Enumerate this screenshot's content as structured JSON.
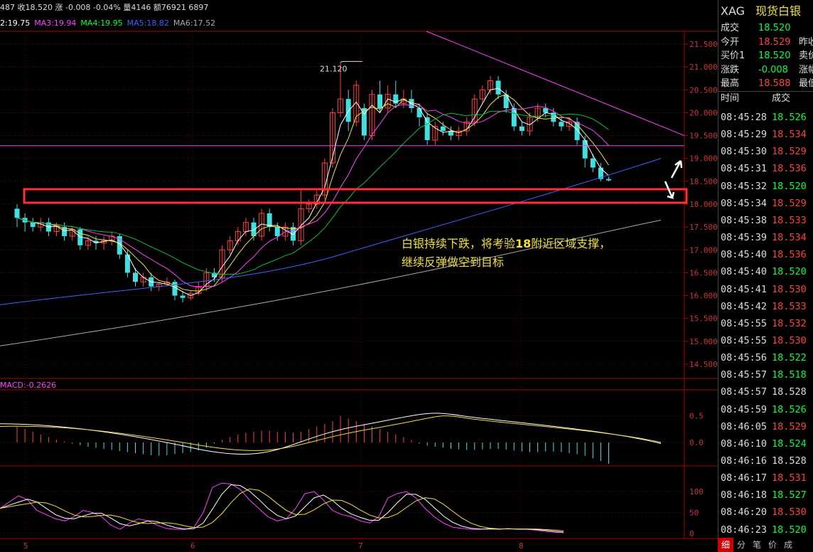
{
  "quote_bar": {
    "price_label": "487 收18.520 涨 -0.008 -0.04% 量4146 额76921 6897"
  },
  "ma_bar": [
    {
      "text": "2:19.75",
      "color": "#ffffff"
    },
    {
      "text": "MA3:19.94",
      "color": "#ff40ff"
    },
    {
      "text": "MA4:19.95",
      "color": "#00ff40"
    },
    {
      "text": "MA5:18.82",
      "color": "#4060ff"
    },
    {
      "text": "MA6:17.52",
      "color": "#aaaaaa"
    }
  ],
  "price_axis": [
    "21.500",
    "21.000",
    "20.500",
    "20.000",
    "19.500",
    "19.000",
    "18.500",
    "18.000",
    "17.500",
    "17.000",
    "16.500",
    "16.000",
    "15.500",
    "15.000",
    "14.500"
  ],
  "peak_label": "21.120",
  "annotation": {
    "line1_a": "白银持续下跌，将考验",
    "line1_b": "18",
    "line1_c": "附近区域支撑，",
    "line2": "继续反弹做空到目标"
  },
  "macd_label": "MACD:-0.2626",
  "macd_axis": [
    "0.5",
    "0.0"
  ],
  "kdj_axis": [
    "100",
    "50",
    "0"
  ],
  "date_axis": [
    "5",
    "6",
    "7",
    "8"
  ],
  "right_panel": {
    "symbol": "XAG",
    "name": "现货白银",
    "fields": [
      {
        "k": "成交",
        "v": "18.520",
        "color": "#00ff40",
        "e": ""
      },
      {
        "k": "今开",
        "v": "18.529",
        "color": "#ff4040",
        "e": "昨收"
      },
      {
        "k": "买价1",
        "v": "18.520",
        "color": "#00ff40",
        "e": "卖价"
      },
      {
        "k": "涨跌",
        "v": "-0.008",
        "color": "#00ff40",
        "e": "涨幅"
      },
      {
        "k": "最高",
        "v": "18.588",
        "color": "#ff4040",
        "e": "最低"
      }
    ],
    "tick_header": {
      "time": "时间",
      "price": "成交"
    },
    "ticks": [
      {
        "t": "08:45:28",
        "p": "18.526",
        "c": "green"
      },
      {
        "t": "08:45:29",
        "p": "18.534",
        "c": "red"
      },
      {
        "t": "08:45:30",
        "p": "18.529",
        "c": "red"
      },
      {
        "t": "08:45:31",
        "p": "18.536",
        "c": "red"
      },
      {
        "t": "08:45:32",
        "p": "18.520",
        "c": "green"
      },
      {
        "t": "08:45:34",
        "p": "18.529",
        "c": "red"
      },
      {
        "t": "08:45:38",
        "p": "18.533",
        "c": "red"
      },
      {
        "t": "08:45:39",
        "p": "18.534",
        "c": "red"
      },
      {
        "t": "08:45:40",
        "p": "18.536",
        "c": "red"
      },
      {
        "t": "08:45:40",
        "p": "18.520",
        "c": "green"
      },
      {
        "t": "08:45:41",
        "p": "18.530",
        "c": "red"
      },
      {
        "t": "08:45:42",
        "p": "18.533",
        "c": "red"
      },
      {
        "t": "08:45:55",
        "p": "18.532",
        "c": "red"
      },
      {
        "t": "08:45:55",
        "p": "18.530",
        "c": "red"
      },
      {
        "t": "08:45:56",
        "p": "18.522",
        "c": "green"
      },
      {
        "t": "08:45:57",
        "p": "18.518",
        "c": "green"
      },
      {
        "t": "08:45:57",
        "p": "18.528",
        "c": "white"
      },
      {
        "t": "08:45:59",
        "p": "18.526",
        "c": "green"
      },
      {
        "t": "08:46:05",
        "p": "18.529",
        "c": "red"
      },
      {
        "t": "08:46:10",
        "p": "18.524",
        "c": "green"
      },
      {
        "t": "08:46:16",
        "p": "18.528",
        "c": "white"
      },
      {
        "t": "08:46:17",
        "p": "18.531",
        "c": "red"
      },
      {
        "t": "08:46:18",
        "p": "18.527",
        "c": "green"
      },
      {
        "t": "08:46:20",
        "p": "18.530",
        "c": "red"
      },
      {
        "t": "08:46:23",
        "p": "18.520",
        "c": "green"
      }
    ],
    "tabs": [
      "细",
      "分",
      "笔",
      "价",
      "成"
    ]
  }
}
